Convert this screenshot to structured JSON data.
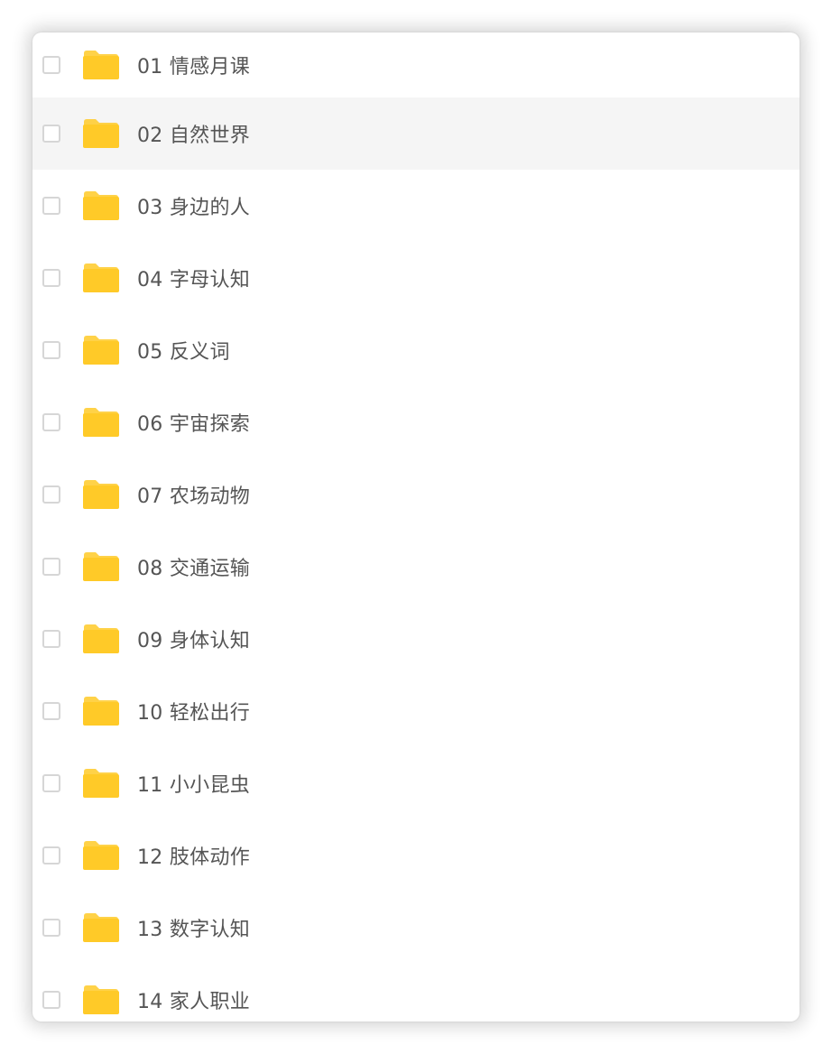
{
  "folder_color": "#FFCA28",
  "items": [
    {
      "name": "01 情感月课",
      "hovered": false
    },
    {
      "name": "02 自然世界",
      "hovered": true
    },
    {
      "name": "03 身边的人",
      "hovered": false
    },
    {
      "name": "04 字母认知",
      "hovered": false
    },
    {
      "name": "05 反义词",
      "hovered": false
    },
    {
      "name": "06 宇宙探索",
      "hovered": false
    },
    {
      "name": "07 农场动物",
      "hovered": false
    },
    {
      "name": "08 交通运输",
      "hovered": false
    },
    {
      "name": "09 身体认知",
      "hovered": false
    },
    {
      "name": "10 轻松出行",
      "hovered": false
    },
    {
      "name": "11 小小昆虫",
      "hovered": false
    },
    {
      "name": "12 肢体动作",
      "hovered": false
    },
    {
      "name": "13 数字认知",
      "hovered": false
    },
    {
      "name": "14 家人职业",
      "hovered": false
    }
  ]
}
